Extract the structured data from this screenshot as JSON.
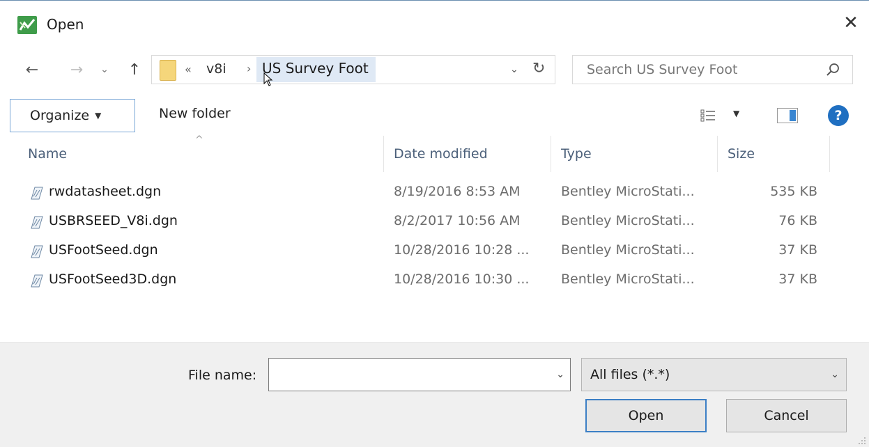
{
  "window": {
    "title": "Open",
    "close_glyph": "✕",
    "icon": "microstation-app-icon"
  },
  "nav": {
    "back_glyph": "←",
    "forward_glyph": "→",
    "recent_glyph": "⌄",
    "up_glyph": "↑",
    "breadcrumb_overflow": "«",
    "breadcrumb_parent": "v8i",
    "breadcrumb_separator": "›",
    "breadcrumb_current": "US Survey Foot",
    "address_dropdown_glyph": "⌄",
    "refresh_glyph": "↻"
  },
  "search": {
    "placeholder": "Search US Survey Foot"
  },
  "toolbar": {
    "organize_label": "Organize",
    "organize_caret": "▼",
    "new_folder_label": "New folder",
    "view_caret": "▼",
    "help_glyph": "?"
  },
  "columns": {
    "sort_indicator": "^",
    "name": "Name",
    "date": "Date modified",
    "type": "Type",
    "size": "Size"
  },
  "files": [
    {
      "name": "rwdatasheet.dgn",
      "date": "8/19/2016 8:53 AM",
      "type": "Bentley MicroStati...",
      "size": "535 KB"
    },
    {
      "name": "USBRSEED_V8i.dgn",
      "date": "8/2/2017 10:56 AM",
      "type": "Bentley MicroStati...",
      "size": "76 KB"
    },
    {
      "name": "USFootSeed.dgn",
      "date": "10/28/2016 10:28 ...",
      "type": "Bentley MicroStati...",
      "size": "37 KB"
    },
    {
      "name": "USFootSeed3D.dgn",
      "date": "10/28/2016 10:30 ...",
      "type": "Bentley MicroStati...",
      "size": "37 KB"
    }
  ],
  "footer": {
    "file_name_label": "File name:",
    "file_name_value": "",
    "file_name_dropdown_glyph": "⌄",
    "file_type_value": "All files (*.*)",
    "file_type_dropdown_glyph": "⌄",
    "open_label": "Open",
    "cancel_label": "Cancel"
  },
  "colors": {
    "accent": "#3c7fc5",
    "help": "#1f6fc1",
    "folder": "#f5d67b",
    "breadcrumb_highlight": "#dfe9f5"
  }
}
